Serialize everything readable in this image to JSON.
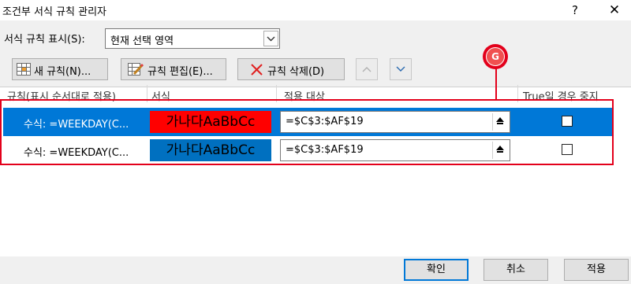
{
  "window": {
    "title": "조건부 서식 규칙 관리자",
    "help": "?",
    "close": "✕"
  },
  "show_rules": {
    "label": "서식 규칙 표시(S):",
    "selected": "현재 선택 영역"
  },
  "toolbar": {
    "new_rule": "새 규칙(N)...",
    "edit_rule": "규칙 편집(E)...",
    "delete_rule": "규칙 삭제(D)"
  },
  "columns": {
    "rule": "규칙(표시 순서대로 적용)",
    "format": "서식",
    "applies_to": "적용 대상",
    "stop_if_true": "True일 경우 중지"
  },
  "rules": [
    {
      "condition": "수식: =WEEKDAY(C...",
      "preview_text": "가나다AaBbCc",
      "preview_bg": "#ff0000",
      "applies_to": "=$C$3:$AF$19",
      "stop_if_true": false,
      "selected": true
    },
    {
      "condition": "수식: =WEEKDAY(C...",
      "preview_text": "가나다AaBbCc",
      "preview_bg": "#0070c0",
      "applies_to": "=$C$3:$AF$19",
      "stop_if_true": false,
      "selected": false
    }
  ],
  "annotation": {
    "label": "G",
    "color": "#e3001b"
  },
  "buttons": {
    "ok": "확인",
    "cancel": "취소",
    "apply": "적용"
  },
  "colors": {
    "selection": "#0078d7",
    "annotation": "#e3001b"
  }
}
